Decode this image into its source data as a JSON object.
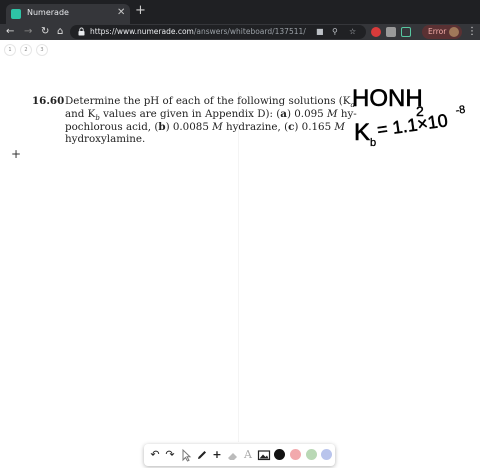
{
  "browser": {
    "tab_title": "Numerade",
    "tab_close": "✕",
    "new_tab": "+",
    "url_main": "https://www.numerade.com",
    "url_path": "/answers/whiteboard/137511/",
    "error_label": "Error",
    "icons": [
      "back-icon",
      "forward-icon",
      "reload-icon",
      "home-icon",
      "lock-icon",
      "video-icon",
      "search-icon",
      "star-icon",
      "menu-icon"
    ],
    "colors": {
      "tabbar": "#1f2023",
      "toolbar": "#35363a",
      "error_pill": "#5a3133",
      "favicon": "#2ec4a6"
    }
  },
  "pages": [
    "1",
    "2",
    "3"
  ],
  "problem": {
    "number": "16.60",
    "lines": [
      "Determine the pH of each of the following solutions (K",
      "and K",
      "pochlorous acid, (",
      "hydroxylamine."
    ],
    "line1_sub": "a",
    "line2_sub": "b",
    "line2_rest": " values are given in Appendix D): (",
    "a_label": "a",
    "line2_end": ") 0.095 ",
    "molar": "M",
    "line2_tail": " hy-",
    "b_label": "b",
    "line3_mid": ") 0.0085 ",
    "line3_mid2": " hydrazine, (",
    "c_label": "c",
    "line3_end": ") 0.165 "
  },
  "handwriting": {
    "line1": "HONH",
    "line1_sub": "2",
    "line2": "K",
    "line2_sub": "b",
    "line2_rest": "= 1.1×10",
    "line2_exp": "-8"
  },
  "drawbar": {
    "tools": [
      "undo-icon",
      "redo-icon",
      "pointer-icon",
      "pen-icon",
      "plus-icon",
      "eraser-icon",
      "text-icon",
      "image-icon"
    ],
    "text_tool": "A",
    "swatches": [
      "#111111",
      "#f2a9ad",
      "#b9d8b5",
      "#b9c4ec"
    ]
  }
}
